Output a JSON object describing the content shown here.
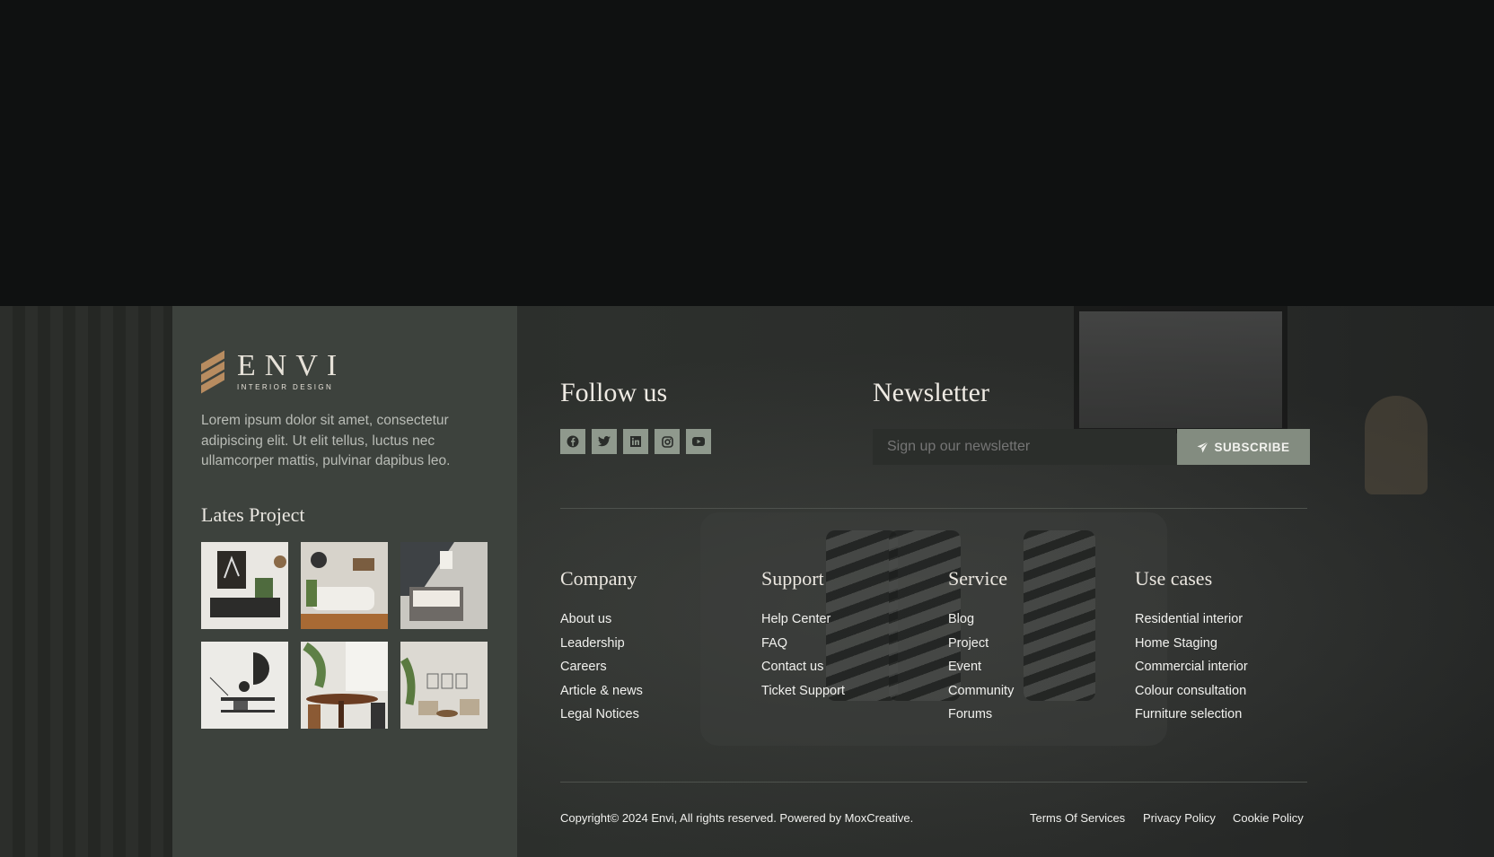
{
  "brand": {
    "name": "ENVI",
    "tagline": "INTERIOR DESIGN",
    "accent": "#b88c60"
  },
  "left": {
    "description": "Lorem ipsum dolor sit amet, consectetur adipiscing elit. Ut elit tellus, luctus nec ullamcorper mattis, pulvinar dapibus leo.",
    "latest_title": "Lates Project",
    "thumbnails": [
      "project-thumbnail-1",
      "project-thumbnail-2",
      "project-thumbnail-3",
      "project-thumbnail-4",
      "project-thumbnail-5",
      "project-thumbnail-6"
    ]
  },
  "follow": {
    "title": "Follow us",
    "icons": [
      "facebook-icon",
      "twitter-icon",
      "linkedin-icon",
      "instagram-icon",
      "youtube-icon"
    ]
  },
  "newsletter": {
    "title": "Newsletter",
    "placeholder": "Sign up our newsletter",
    "button": "SUBSCRIBE",
    "button_icon": "paper-plane-icon"
  },
  "columns": [
    {
      "title": "Company",
      "items": [
        "About us",
        "Leadership",
        "Careers",
        "Article & news",
        "Legal Notices"
      ]
    },
    {
      "title": "Support",
      "items": [
        "Help Center",
        "FAQ",
        "Contact us",
        "Ticket Support"
      ]
    },
    {
      "title": "Service",
      "items": [
        "Blog",
        "Project",
        "Event",
        "Community",
        "Forums"
      ]
    },
    {
      "title": "Use cases",
      "items": [
        "Residential interior",
        "Home Staging",
        "Commercial interior",
        "Colour consultation",
        "Furniture selection"
      ]
    }
  ],
  "bottom": {
    "copyright": "Copyright© 2024 Envi, All rights reserved. Powered by MoxCreative.",
    "links": [
      "Terms Of Services",
      "Privacy Policy",
      "Cookie Policy"
    ]
  }
}
